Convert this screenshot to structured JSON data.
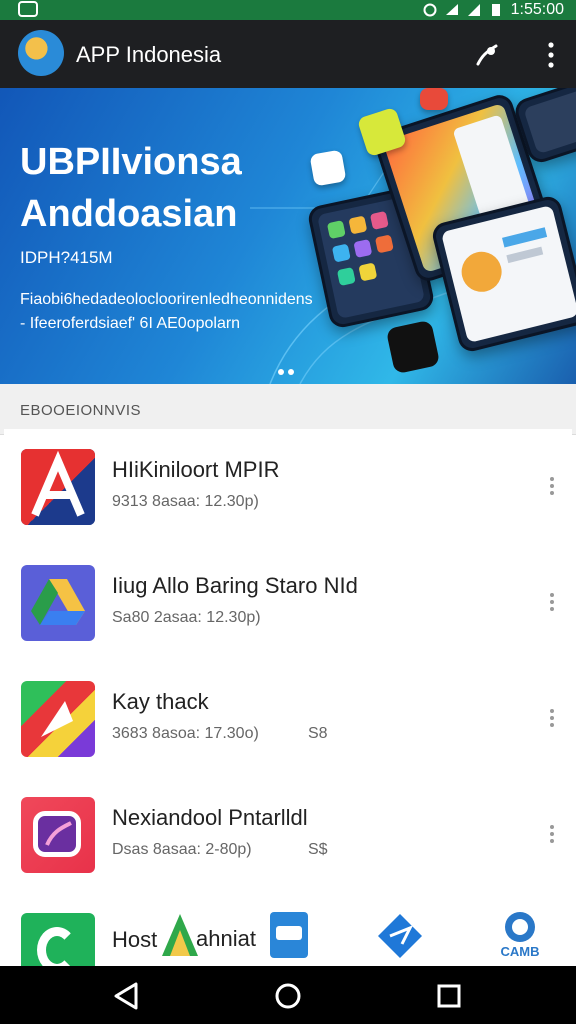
{
  "status_bar": {
    "time": "1:55:00",
    "icons": [
      "app-notification-icon",
      "alarm-icon",
      "wifi-icon",
      "signal-icon",
      "battery-icon"
    ]
  },
  "app_bar": {
    "title": "APP Indonesia",
    "icons": [
      "app-logo-icon",
      "share-icon",
      "more-vert-icon"
    ]
  },
  "banner": {
    "title_line1": "UBPIIvionsa",
    "title_line2": "Anddoasian",
    "subtitle": "IDPH?415M",
    "desc_line1": "Fiaobi6hedadeolocloorirenledheonnidens",
    "desc_line2": "- Ifeeroferdsiaef' 6I AE0opolarn"
  },
  "section": {
    "label": "EBOOEIONNVIS"
  },
  "apps": [
    {
      "name": "HIiKiniloort MPIR",
      "meta": "9313 8asaa: 12.30p)",
      "price": ""
    },
    {
      "name": "Iiug Allo Baring Staro NId",
      "meta": "Sa80 2asaa: 12.30p)",
      "price": ""
    },
    {
      "name": "Kay thack",
      "meta": "3683 8asoa: 17.30o)",
      "price": "S8"
    },
    {
      "name": "Nexiandool Pntarlldl",
      "meta": "Dsas 8asaa: 2-80p)",
      "price": "S$"
    },
    {
      "name": "Host",
      "meta": "",
      "price": ""
    }
  ],
  "bottom_overlay": {
    "partial_text": "ahniat",
    "cams_label": "CAMB"
  },
  "colors": {
    "status_bar": "#1b7a3e",
    "app_bar": "#1e1f22",
    "banner": "#1f86d6",
    "navbar": "#000000"
  }
}
